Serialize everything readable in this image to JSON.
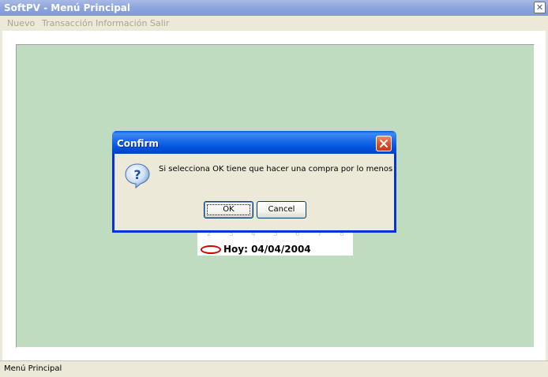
{
  "window": {
    "title": "SoftPV - Menú Principal",
    "close_glyph": "✕"
  },
  "menu": [
    {
      "label": "Nuevo"
    },
    {
      "label": "Transacción"
    },
    {
      "label": "Información"
    },
    {
      "label": "Salir"
    }
  ],
  "calendar": {
    "days": [
      "2",
      "3",
      "4",
      "5",
      "6",
      "7",
      "8"
    ],
    "today_label": "Hoy: 04/04/2004"
  },
  "dialog": {
    "title": "Confirm",
    "message": "Si selecciona OK tiene que hacer una compra por lo menos",
    "ok_label": "OK",
    "cancel_label": "Cancel",
    "icon": "question-icon"
  },
  "status": {
    "text": "Menú Principal"
  },
  "colors": {
    "workspace": "#c0dcc0",
    "title_bar": "#8ea6de",
    "dialog_title": "#0052dd",
    "close_red": "#e0502c"
  }
}
